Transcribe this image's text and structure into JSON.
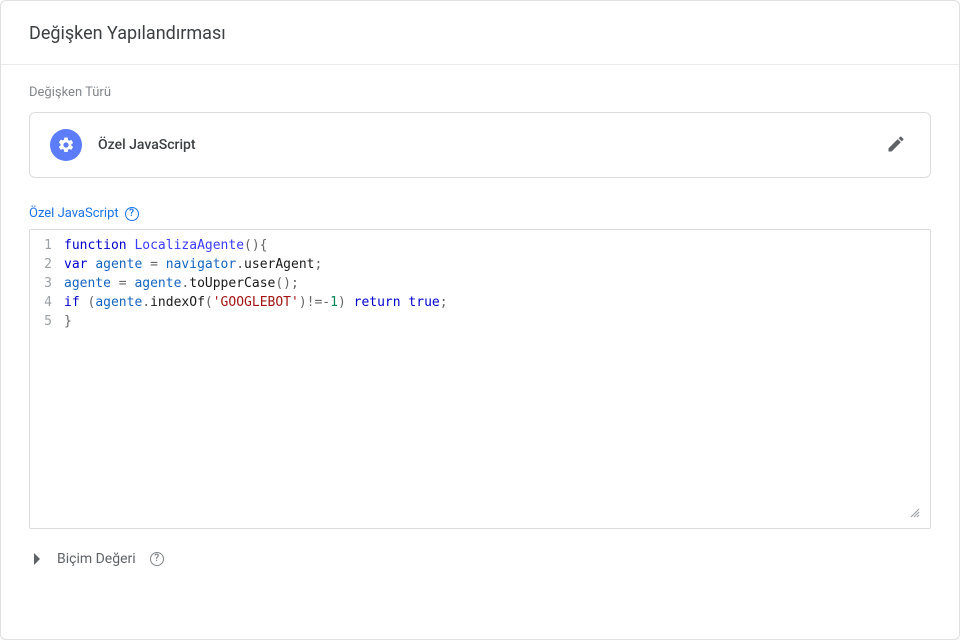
{
  "header": {
    "title": "Değişken Yapılandırması"
  },
  "section": {
    "variable_type_label": "Değişken Türü",
    "js_type_label": "Özel JavaScript"
  },
  "editor": {
    "title": "Özel JavaScript",
    "lines": [
      "function LocalizaAgente(){",
      "var agente = navigator.userAgent;",
      "agente = agente.toUpperCase();",
      "if (agente.indexOf('GOOGLEBOT')!=-1) return true;",
      "}"
    ]
  },
  "format": {
    "label": "Biçim Değeri"
  },
  "icons": {
    "gear": "gear-icon",
    "pencil": "pencil-icon",
    "help": "?",
    "resize": "resize-icon",
    "chevron": "chevron-right-icon"
  }
}
